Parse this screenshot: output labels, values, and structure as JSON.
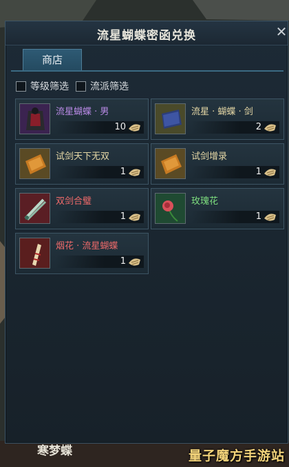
{
  "window": {
    "title": "流星蝴蝶密函兑换",
    "close_icon": "close-icon"
  },
  "tabs": [
    {
      "label": "商店",
      "active": true
    }
  ],
  "filters": [
    {
      "label": "等级筛选",
      "checked": false
    },
    {
      "label": "流派筛选",
      "checked": false
    }
  ],
  "colors": {
    "purple": "#b98ae6",
    "gold": "#e6d8a6",
    "red": "#ee6a6a",
    "green": "#7fe07f"
  },
  "items": [
    {
      "name": "流星蝴蝶 · 男",
      "qty": "10",
      "icon": "dark-costume-icon",
      "color": "#b98ae6"
    },
    {
      "name": "流星 · 蝴蝶 · 剑",
      "qty": "2",
      "icon": "blue-book-icon",
      "color": "#e6d8a6"
    },
    {
      "name": "试剑天下无双",
      "qty": "1",
      "icon": "orange-book-icon",
      "color": "#e6d8a6"
    },
    {
      "name": "试剑增录",
      "qty": "1",
      "icon": "orange-book-icon",
      "color": "#e6d8a6"
    },
    {
      "name": "双剑合璧",
      "qty": "1",
      "icon": "twin-swords-icon",
      "color": "#ee6a6a"
    },
    {
      "name": "玫瑰花",
      "qty": "1",
      "icon": "rose-icon",
      "color": "#7fe07f"
    },
    {
      "name": "烟花 · 流星蝴蝶",
      "qty": "1",
      "icon": "firework-icon",
      "color": "#ee6a6a"
    }
  ],
  "currency_icon": "shell-currency-icon",
  "background_text": "寒梦蝶",
  "watermark": "量子魔方手游站"
}
